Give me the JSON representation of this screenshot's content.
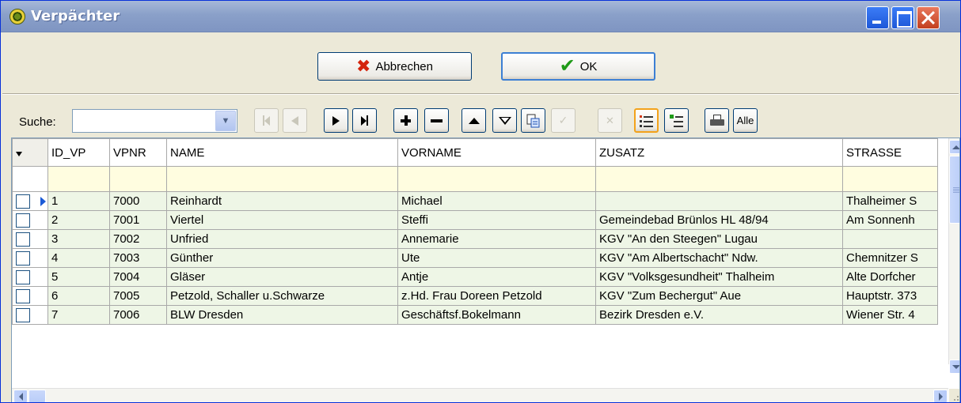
{
  "window": {
    "title": "Verpächter"
  },
  "buttons": {
    "cancel_label": "Abbrechen",
    "ok_label": "OK"
  },
  "search": {
    "label": "Suche:",
    "value": ""
  },
  "toolbar": {
    "items": [
      {
        "name": "first-record-button",
        "icon": "first-icon",
        "enabled": false
      },
      {
        "name": "prev-record-button",
        "icon": "prev-icon",
        "enabled": false
      },
      {
        "name": "next-record-button",
        "icon": "next-icon",
        "enabled": true
      },
      {
        "name": "last-record-button",
        "icon": "last-icon",
        "enabled": true
      },
      {
        "name": "insert-record-button",
        "icon": "plus-icon",
        "enabled": true
      },
      {
        "name": "delete-record-button",
        "icon": "minus-icon",
        "enabled": true
      },
      {
        "name": "edit-record-button",
        "icon": "up-icon",
        "enabled": true
      },
      {
        "name": "filter-button",
        "icon": "filter-icon",
        "enabled": true
      },
      {
        "name": "copy-button",
        "icon": "copy-icon",
        "enabled": true
      },
      {
        "name": "post-button",
        "icon": "check-icon",
        "enabled": false
      },
      {
        "name": "cancel-edit-button",
        "icon": "x-icon",
        "enabled": false
      },
      {
        "name": "select-list-button",
        "icon": "list-icon",
        "enabled": true
      },
      {
        "name": "add-list-button",
        "icon": "list-add-icon",
        "enabled": true
      },
      {
        "name": "print-button",
        "icon": "printer-icon",
        "enabled": true
      },
      {
        "name": "all-button",
        "label": "Alle",
        "enabled": true
      }
    ]
  },
  "grid": {
    "columns": [
      "ID_VP",
      "VPNR",
      "NAME",
      "VORNAME",
      "ZUSATZ",
      "STRASSE"
    ],
    "rows": [
      {
        "id": "1",
        "vpnr": "7000",
        "name": "Reinhardt",
        "vorname": "Michael",
        "zusatz": "",
        "strasse": "Thalheimer S",
        "current": true
      },
      {
        "id": "2",
        "vpnr": "7001",
        "name": "Viertel",
        "vorname": "Steffi",
        "zusatz": "Gemeindebad Brünlos   HL 48/94",
        "strasse": "Am Sonnenh",
        "current": false
      },
      {
        "id": "3",
        "vpnr": "7002",
        "name": "Unfried",
        "vorname": "Annemarie",
        "zusatz": "KGV \"An den Steegen\" Lugau",
        "strasse": "",
        "current": false
      },
      {
        "id": "4",
        "vpnr": "7003",
        "name": "Günther",
        "vorname": "Ute",
        "zusatz": "KGV \"Am Albertschacht\" Ndw.",
        "strasse": "Chemnitzer S",
        "current": false
      },
      {
        "id": "5",
        "vpnr": "7004",
        "name": "Gläser",
        "vorname": "Antje",
        "zusatz": "KGV \"Volksgesundheit\" Thalheim",
        "strasse": "Alte Dorfcher",
        "current": false
      },
      {
        "id": "6",
        "vpnr": "7005",
        "name": "Petzold, Schaller u.Schwarze",
        "vorname": "z.Hd. Frau Doreen Petzold",
        "zusatz": "KGV \"Zum Bechergut\" Aue",
        "strasse": "Hauptstr. 373",
        "current": false
      },
      {
        "id": "7",
        "vpnr": "7006",
        "name": "BLW Dresden",
        "vorname": "Geschäftsf.Bokelmann",
        "zusatz": "Bezirk Dresden e.V.",
        "strasse": "Wiener Str. 4",
        "current": false
      }
    ]
  }
}
